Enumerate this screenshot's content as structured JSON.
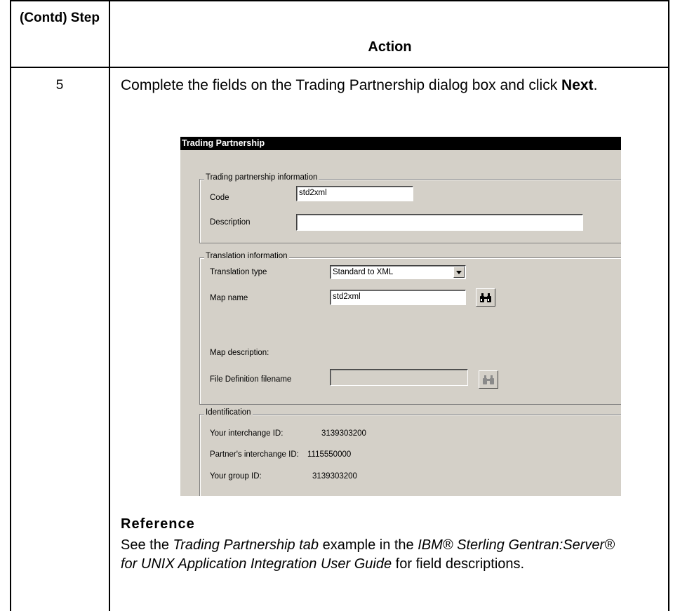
{
  "table": {
    "step_header": "(Contd) Step",
    "action_header": "Action",
    "step_number": "5",
    "action_before": "Complete the fields on the Trading Partnership dialog box and click ",
    "action_bold": "Next",
    "action_after": "."
  },
  "dialog": {
    "title": "Trading Partnership",
    "partnership_group": "Trading partnership information",
    "code_label": "Code",
    "code_value": "std2xml",
    "description_label": "Description",
    "description_value": "",
    "translation_group": "Translation information",
    "translation_type_label": "Translation type",
    "translation_type_value": "Standard to XML",
    "map_name_label": "Map name",
    "map_name_value": "std2xml",
    "map_description_label": "Map description:",
    "file_def_label": "File Definition filename",
    "file_def_value": "",
    "identification_group": "Identification",
    "interchange_id_label": "Your interchange ID:",
    "interchange_id_value": "3139303200",
    "partner_id_label": "Partner's interchange ID:",
    "partner_id_value": "1115550000",
    "group_id_label": "Your group ID:",
    "group_id_value": "3139303200",
    "icons": {
      "search": "binoculars-icon",
      "dropdown": "chevron-down-icon"
    }
  },
  "reference": {
    "heading": "Reference",
    "t1": "See the ",
    "i1": "Trading Partnership tab",
    "t2": " example in the ",
    "i2": "IBM® Sterling Gentran:Server® for UNIX Application Integration User Guide",
    "t3": " for field descriptions."
  }
}
